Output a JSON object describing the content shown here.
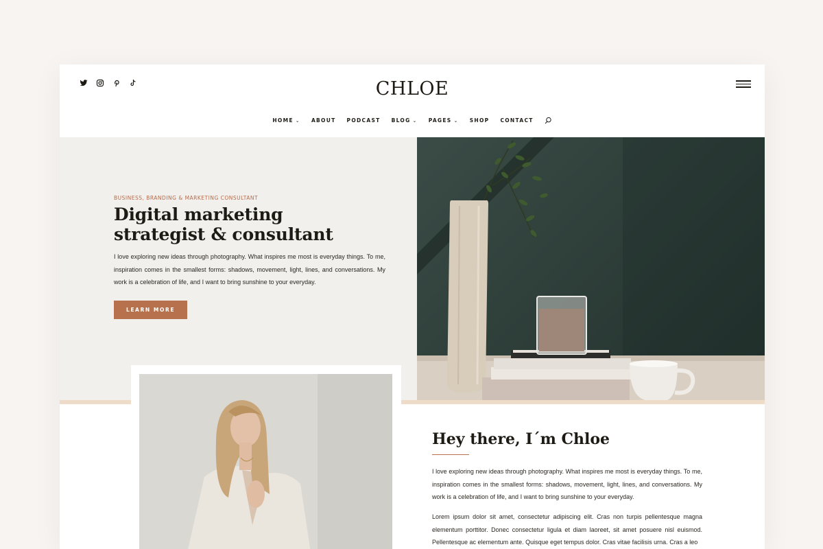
{
  "header": {
    "logo": "CHLOE",
    "social_icons": [
      "twitter-icon",
      "instagram-icon",
      "pinterest-icon",
      "tiktok-icon"
    ],
    "nav": [
      {
        "label": "HOME",
        "dropdown": true
      },
      {
        "label": "ABOUT",
        "dropdown": false
      },
      {
        "label": "PODCAST",
        "dropdown": false
      },
      {
        "label": "BLOG",
        "dropdown": true
      },
      {
        "label": "PAGES",
        "dropdown": true
      },
      {
        "label": "SHOP",
        "dropdown": false
      },
      {
        "label": "CONTACT",
        "dropdown": false
      }
    ],
    "chevron": "⌄",
    "search_icon": "search-icon",
    "menu_icon": "hamburger-menu-icon"
  },
  "hero": {
    "eyebrow": "BUSINESS, BRANDING & MARKETING CONSULTANT",
    "title": "Digital marketing strategist & consultant",
    "text": "I love exploring new ideas through photography. What inspires me most is everyday things. To me, inspiration comes in the smallest forms: shadows, movement, light, lines, and conversations. My work is a celebration of life, and I want to bring sunshine to your everyday.",
    "button": "LEARN MORE"
  },
  "about": {
    "title": "Hey there, I´m Chloe",
    "text": "I love exploring new ideas through photography. What inspires me most is everyday things. To me, inspiration comes in the smallest forms: shadows, movement, light, lines, and conversations. My work is a celebration of life, and I want to bring sunshine to your everyday.",
    "text2": "Lorem ipsum dolor sit amet, consectetur adipiscing elit. Cras non turpis pellentesque magna elementum porttitor. Donec consectetur ligula et diam laoreet, sit amet posuere nisl euismod. Pellentesque ac elementum ante. Quisque eget tempus dolor. Cras vitae facilisis urna. Cras a leo"
  },
  "colors": {
    "accent": "#b8714d",
    "hero_bg": "#f2f0ec",
    "strip": "#efdcc8",
    "text": "#1e1b15"
  }
}
